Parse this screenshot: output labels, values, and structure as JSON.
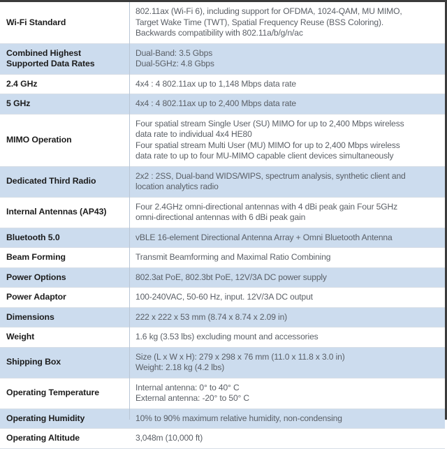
{
  "document": {
    "title": "Access Point Technical Specifications",
    "colors": {
      "band": "#ccdcee",
      "row_rule": "#d7dee7",
      "frame": "#3b3b3b",
      "label_text": "#1c1c1c",
      "value_text": "#5a5f66"
    }
  },
  "spec_table": {
    "rows": [
      {
        "label": [
          "Wi-Fi Standard"
        ],
        "value": [
          "802.11ax (Wi-Fi 6), including support for OFDMA, 1024-QAM, MU MIMO,",
          "Target Wake Time (TWT), Spatial Frequency Reuse (BSS Coloring).",
          "Backwards compatibility with 802.11a/b/g/n/ac"
        ],
        "banded": false
      },
      {
        "label": [
          "Combined Highest",
          "Supported Data Rates"
        ],
        "value": [
          "Dual-Band: 3.5 Gbps",
          "Dual-5GHz: 4.8 Gbps"
        ],
        "banded": true
      },
      {
        "label": [
          "2.4 GHz"
        ],
        "value": [
          "4x4 : 4 802.11ax up to 1,148 Mbps data rate"
        ],
        "banded": false
      },
      {
        "label": [
          "5 GHz"
        ],
        "value": [
          "4x4 : 4 802.11ax up to 2,400 Mbps data rate"
        ],
        "banded": true
      },
      {
        "label": [
          "MIMO Operation"
        ],
        "value": [
          "Four spatial stream Single User (SU) MIMO for up to 2,400 Mbps wireless",
          "data rate to individual 4x4 HE80",
          "Four spatial stream Multi User (MU) MIMO for up to 2,400 Mbps wireless",
          "data rate to up to four MU-MIMO capable client devices simultaneously"
        ],
        "banded": false
      },
      {
        "label": [
          "Dedicated Third Radio"
        ],
        "value": [
          "2x2 : 2SS, Dual-band WIDS/WIPS, spectrum analysis, synthetic client and",
          "location analytics radio"
        ],
        "banded": true
      },
      {
        "label": [
          "Internal Antennas (AP43)"
        ],
        "value": [
          "Four 2.4GHz omni-directional antennas with 4 dBi peak gain Four 5GHz",
          "omni-directional antennas with 6 dBi peak gain"
        ],
        "banded": false
      },
      {
        "label": [
          "Bluetooth 5.0"
        ],
        "value": [
          "vBLE 16-element Directional Antenna Array + Omni Bluetooth Antenna"
        ],
        "banded": true
      },
      {
        "label": [
          "Beam Forming"
        ],
        "value": [
          "Transmit Beamforming and Maximal Ratio Combining"
        ],
        "banded": false
      },
      {
        "label": [
          "Power Options"
        ],
        "value": [
          "802.3at PoE, 802.3bt PoE, 12V/3A DC power supply"
        ],
        "banded": true
      },
      {
        "label": [
          "Power Adaptor"
        ],
        "value": [
          "100-240VAC, 50-60 Hz, input. 12V/3A DC output"
        ],
        "banded": false
      },
      {
        "label": [
          "Dimensions"
        ],
        "value": [
          "222 x 222 x 53 mm (8.74 x 8.74 x 2.09 in)"
        ],
        "banded": true
      },
      {
        "label": [
          "Weight"
        ],
        "value": [
          "1.6 kg (3.53 lbs) excluding mount and accessories"
        ],
        "banded": false
      },
      {
        "label": [
          "Shipping Box"
        ],
        "value": [
          "Size (L x W x H): 279 x 298 x 76 mm (11.0 x 11.8 x 3.0 in)",
          "Weight: 2.18 kg (4.2 lbs)"
        ],
        "banded": true
      },
      {
        "label": [
          "Operating Temperature"
        ],
        "value": [
          "Internal antenna: 0° to 40° C",
          "External antenna: -20° to 50° C"
        ],
        "banded": false
      },
      {
        "label": [
          "Operating Humidity"
        ],
        "value": [
          "10% to 90% maximum relative humidity, non-condensing"
        ],
        "banded": true
      },
      {
        "label": [
          "Operating Altitude"
        ],
        "value": [
          "3,048m (10,000 ft)"
        ],
        "banded": false
      }
    ]
  }
}
